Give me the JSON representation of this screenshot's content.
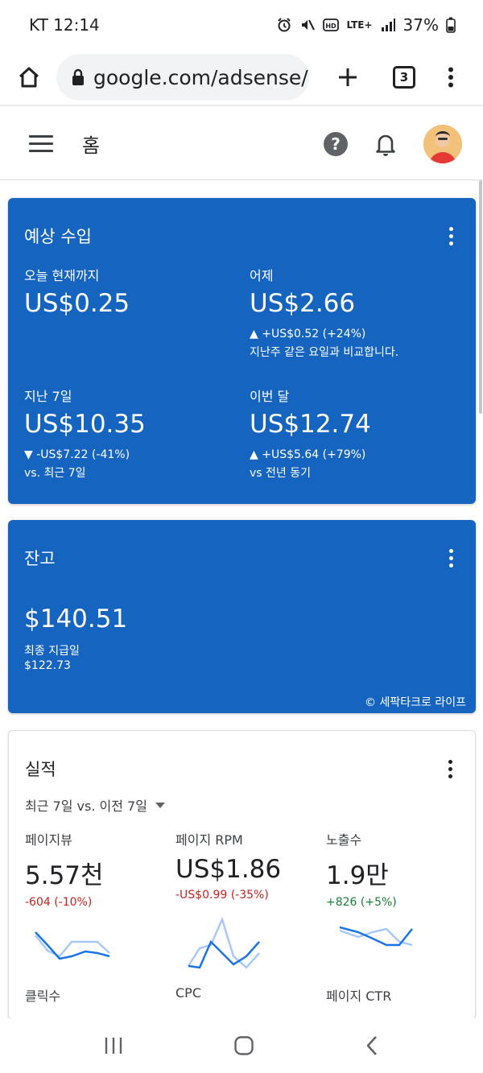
{
  "status": {
    "carrier_time": "KT 12:14",
    "network": "LTE+",
    "battery": "37%"
  },
  "browser": {
    "url": "google.com/adsense/",
    "tab_count": "3"
  },
  "app": {
    "title": "홈"
  },
  "earnings": {
    "title": "예상 수입",
    "today": {
      "label": "오늘 현재까지",
      "value": "US$0.25"
    },
    "yesterday": {
      "label": "어제",
      "value": "US$2.66",
      "delta": "▲ +US$0.52 (+24%)",
      "note": "지난주 같은 요일과 비교합니다."
    },
    "last7": {
      "label": "지난 7일",
      "value": "US$10.35",
      "delta": "▼ -US$7.22 (-41%)",
      "note": "vs. 최근 7일"
    },
    "this_month": {
      "label": "이번 달",
      "value": "US$12.74",
      "delta": "▲ +US$5.64 (+79%)",
      "note": "vs 전년 동기"
    }
  },
  "balance": {
    "title": "잔고",
    "value": "$140.51",
    "last_payment_label": "최종 지급일",
    "last_payment_value": "$122.73",
    "watermark": "© 세팍타크로 라이프"
  },
  "performance": {
    "title": "실적",
    "range": "최근 7일 vs. 이전 7일",
    "metrics": [
      {
        "label": "페이지뷰",
        "value": "5.57천",
        "delta": "-604 (-10%)",
        "trend": "negative"
      },
      {
        "label": "페이지 RPM",
        "value": "US$1.86",
        "delta": "-US$0.99 (-35%)",
        "trend": "negative"
      },
      {
        "label": "노출수",
        "value": "1.9만",
        "delta": "+826 (+5%)",
        "trend": "positive"
      }
    ],
    "next_labels": [
      "클릭수",
      "CPC",
      "페이지 CTR"
    ]
  },
  "colors": {
    "card_blue": "#1565c0",
    "negative": "#c5221f",
    "positive": "#188038",
    "spark_current": "#1a73e8",
    "spark_previous": "#a8c7fa"
  },
  "icons": [
    "home-icon",
    "lock-icon",
    "plus-icon",
    "more-vert-icon",
    "menu-icon",
    "help-icon",
    "bell-icon",
    "avatar",
    "caret-down-icon",
    "recents-icon",
    "home-nav-icon",
    "back-icon"
  ]
}
